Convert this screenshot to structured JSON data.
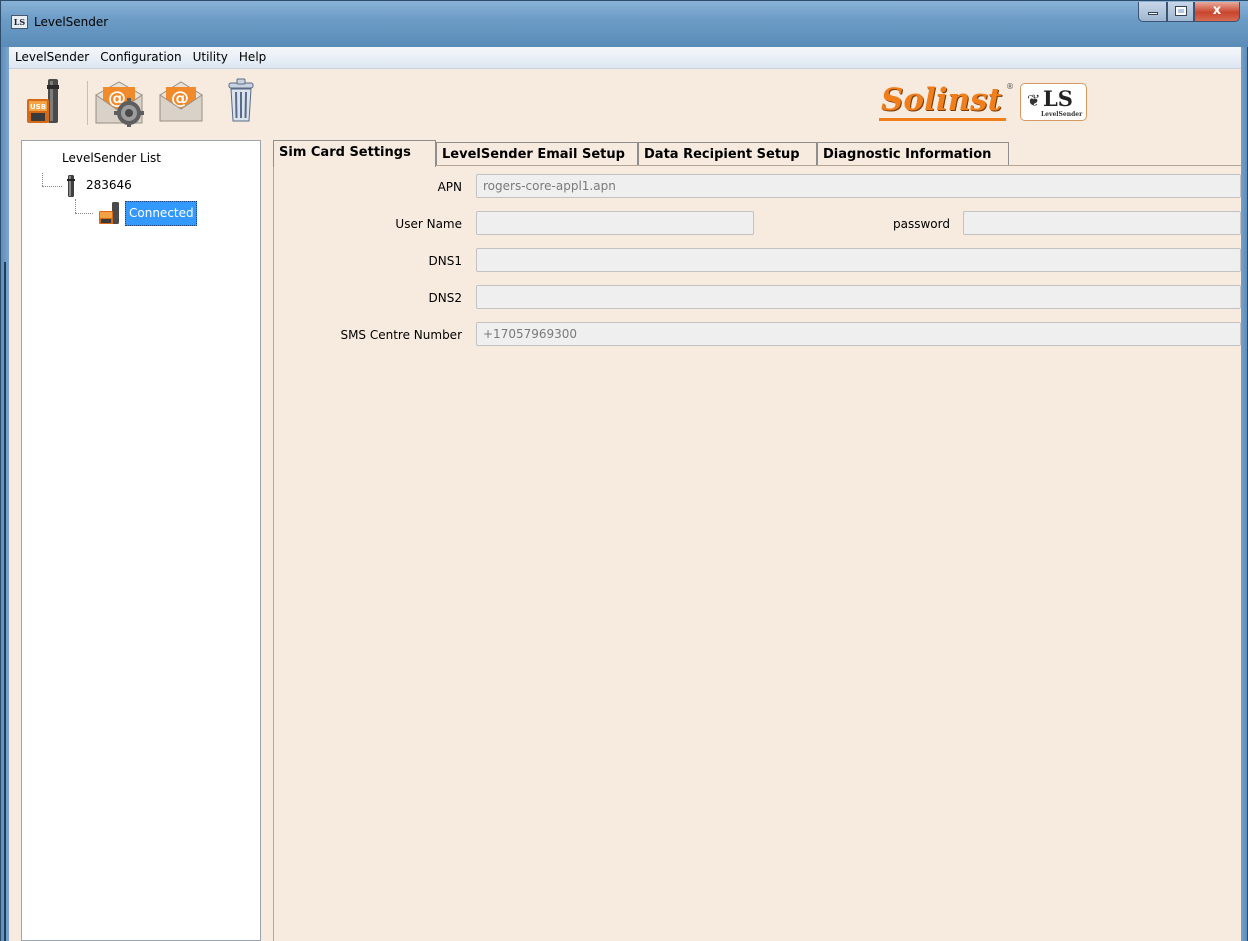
{
  "window": {
    "title": "LevelSender",
    "icon_text": "LS",
    "close_glyph": "x"
  },
  "menu": [
    "LevelSender",
    "Configuration",
    "Utility",
    "Help"
  ],
  "toolbar": {
    "buttons": [
      {
        "icon": "usb-levelsender-icon"
      },
      {
        "icon": "email-settings-icon"
      },
      {
        "icon": "email-icon"
      },
      {
        "icon": "trash-icon"
      }
    ]
  },
  "logo": {
    "brand": "Solinst",
    "reg": "®",
    "product": "LS",
    "product_sub": "LevelSender"
  },
  "tree": {
    "title": "LevelSender List",
    "device_id": "283646",
    "status": "Connected"
  },
  "tabs": [
    "Sim Card Settings",
    "LevelSender Email Setup",
    "Data Recipient Setup",
    "Diagnostic Information"
  ],
  "active_tab": "Sim Card Settings",
  "form": {
    "apn_label": "APN",
    "apn_value": "rogers-core-appl1.apn",
    "username_label": "User Name",
    "username_value": "",
    "password_label": "password",
    "password_value": "",
    "dns1_label": "DNS1",
    "dns1_value": "",
    "dns2_label": "DNS2",
    "dns2_value": "",
    "sms_label": "SMS Centre Number",
    "sms_value": "+17057969300"
  },
  "colors": {
    "background": "#f7ebdf",
    "selection": "#3399ff",
    "brand_orange": "#f07e1b"
  }
}
